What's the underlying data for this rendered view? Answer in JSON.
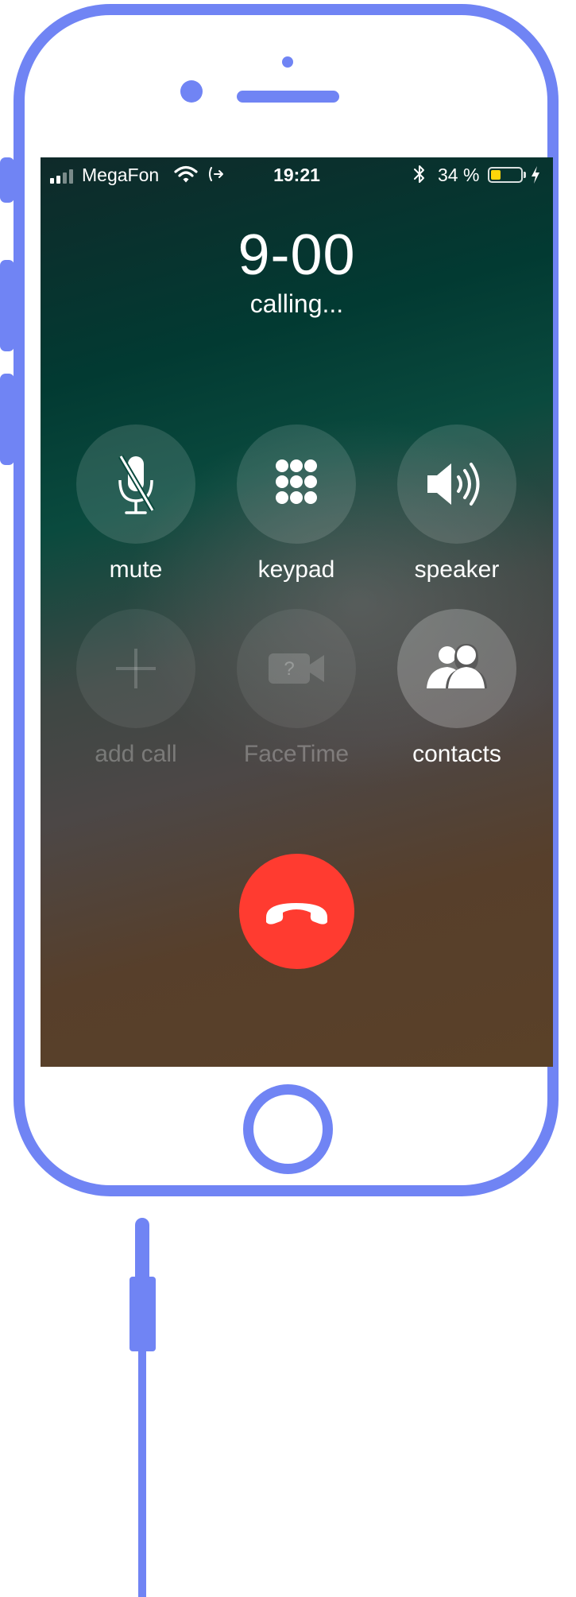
{
  "status_bar": {
    "carrier": "MegaFon",
    "time": "19:21",
    "battery_percent": "34 %",
    "battery_level": 0.34,
    "signal_bars": 2
  },
  "call": {
    "number": "9-00",
    "status": "calling..."
  },
  "buttons": {
    "mute": {
      "label": "mute",
      "icon": "mic-off-icon",
      "enabled": true
    },
    "keypad": {
      "label": "keypad",
      "icon": "keypad-icon",
      "enabled": true
    },
    "speaker": {
      "label": "speaker",
      "icon": "speaker-icon",
      "enabled": true
    },
    "add_call": {
      "label": "add call",
      "icon": "plus-icon",
      "enabled": false
    },
    "facetime": {
      "label": "FaceTime",
      "icon": "facetime-icon",
      "enabled": false
    },
    "contacts": {
      "label": "contacts",
      "icon": "contacts-icon",
      "enabled": true
    }
  },
  "end_call": {
    "icon": "hang-up-icon",
    "color": "#ff3b30"
  },
  "colors": {
    "frame": "#7084f4",
    "battery_fill": "#ffd60a"
  }
}
